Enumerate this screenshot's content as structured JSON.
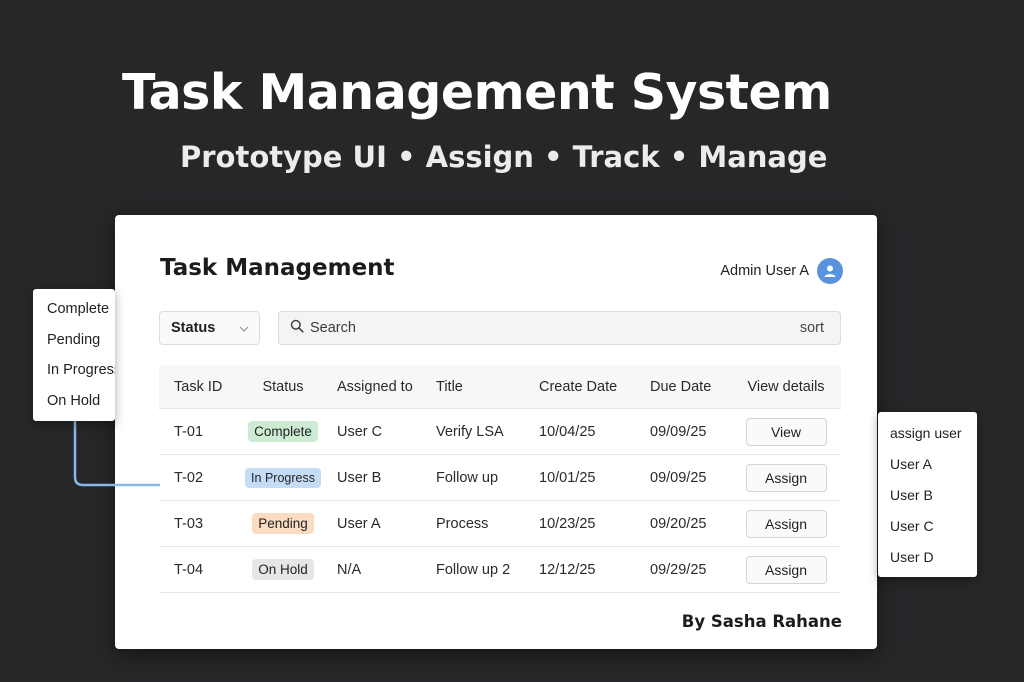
{
  "hero": {
    "title": "Task Management System",
    "subtitle": "Prototype UI • Assign • Track • Manage"
  },
  "app": {
    "title": "Task Management",
    "user_name": "Admin User A",
    "avatar_icon": "user-icon",
    "accent_color": "#5a93dd"
  },
  "toolbar": {
    "status_filter_label": "Status",
    "status_filter_icon": "chevron-down-icon",
    "search_placeholder": "Search",
    "search_icon": "search-icon",
    "sort_label": "sort"
  },
  "table": {
    "columns": [
      "Task ID",
      "Status",
      "Assigned to",
      "Title",
      "Create Date",
      "Due Date",
      "View details"
    ],
    "rows": [
      {
        "id": "T-01",
        "status": "Complete",
        "assigned": "User C",
        "title": "Verify LSA",
        "created": "10/04/25",
        "due": "09/09/25",
        "action": "View"
      },
      {
        "id": "T-02",
        "status": "In Progress",
        "assigned": "User B",
        "title": "Follow up",
        "created": "10/01/25",
        "due": "09/09/25",
        "action": "Assign"
      },
      {
        "id": "T-03",
        "status": "Pending",
        "assigned": "User A",
        "title": "Process",
        "created": "10/23/25",
        "due": "09/20/25",
        "action": "Assign"
      },
      {
        "id": "T-04",
        "status": "On Hold",
        "assigned": "N/A",
        "title": "Follow up 2",
        "created": "12/12/25",
        "due": "09/29/25",
        "action": "Assign"
      }
    ]
  },
  "status_colors": {
    "Complete": "#cdebd3",
    "In Progress": "#c5dcf7",
    "Pending": "#fbdcc0",
    "On Hold": "#e6e6e8"
  },
  "status_menu": {
    "items": [
      "Complete",
      "Pending",
      "In Progress",
      "On Hold"
    ]
  },
  "assign_menu": {
    "items": [
      "assign user",
      "User A",
      "User B",
      "User C",
      "User D"
    ]
  },
  "footer": {
    "author": "By Sasha Rahane"
  }
}
